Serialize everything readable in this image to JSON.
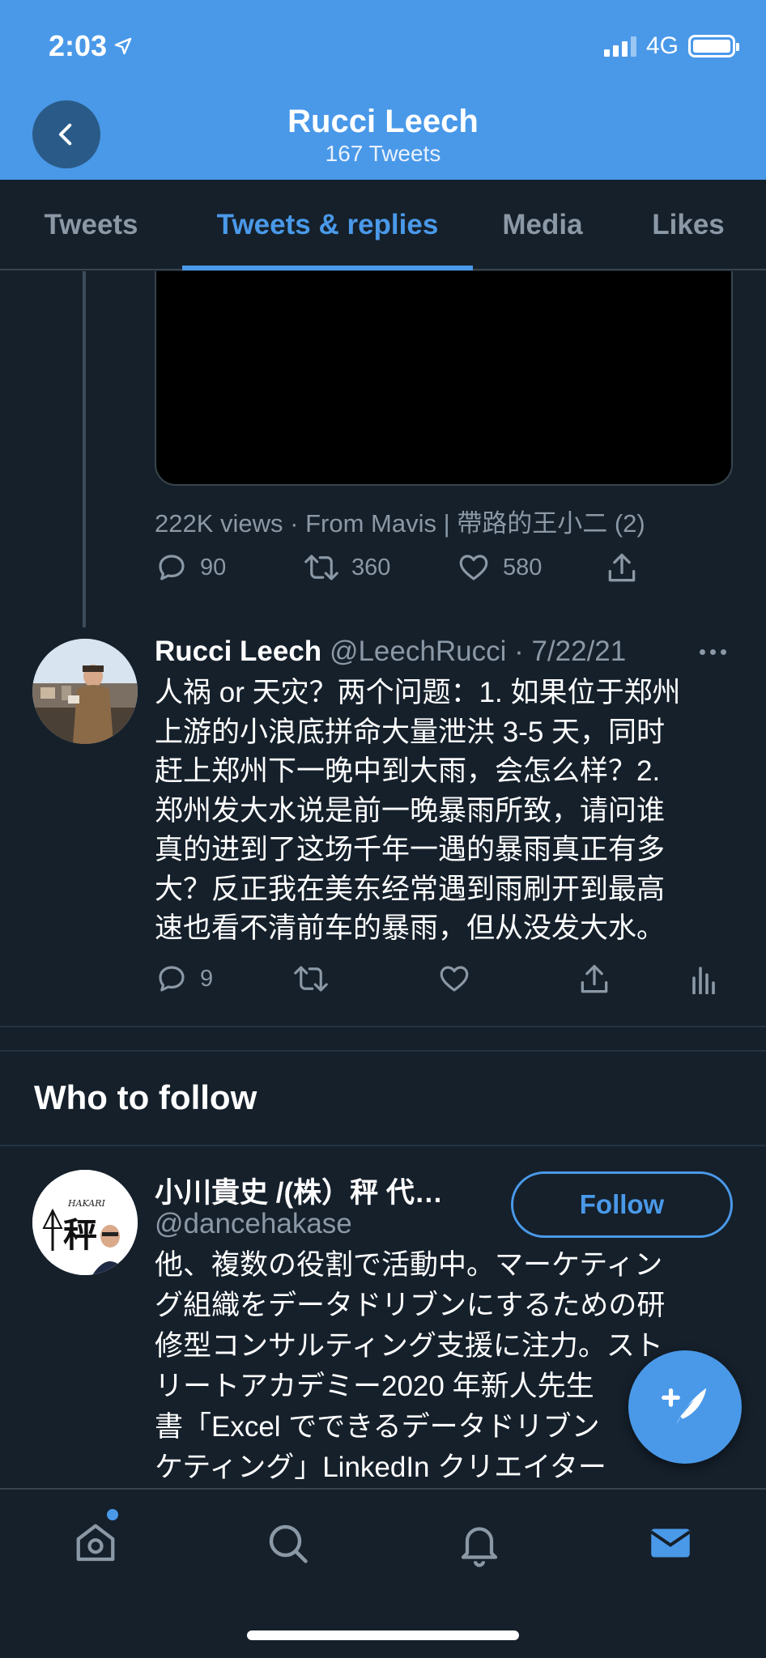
{
  "status_bar": {
    "time": "2:03",
    "network": "4G"
  },
  "header": {
    "name": "Rucci Leech",
    "tweet_count": "167 Tweets"
  },
  "tabs": [
    {
      "label": "Tweets"
    },
    {
      "label": "Tweets & replies",
      "active": true
    },
    {
      "label": "Media"
    },
    {
      "label": "Likes"
    }
  ],
  "tweet_prev": {
    "views": "222K views · From Mavis | 帶路的王小二 (2)",
    "reply_count": "90",
    "retweet_count": "360",
    "like_count": "580"
  },
  "tweet": {
    "name": "Rucci Leech",
    "meta": "@LeechRucci · 7/22/21",
    "text": "人祸 or 天灾？两个问题：1. 如果位于郑州\n上游的小浪底拼命大量泄洪 3-5 天，同时\n赶上郑州下一晚中到大雨，会怎么样？2.\n郑州发大水说是前一晚暴雨所致，请问谁\n真的进到了这场千年一遇的暴雨真正有多\n大？反正我在美东经常遇到雨刷开到最高\n速也看不清前车的暴雨，但从没发大水。",
    "reply_count": "9"
  },
  "who_to_follow": {
    "title": "Who to follow",
    "name": "小川貴史 /(株）秤 代…",
    "handle": "@dancehakase",
    "follow_label": "Follow",
    "bio": "他、複数の役割で活動中。マーケティン\nグ組織をデータドリブンにするための研\n修型コンサルティング支援に注力。スト\nリートアカデミー2020 年新人先生\n書「Excel でできるデータドリブン\nケティング」LinkedIn クリエイター",
    "avatar_text": "HAKARI",
    "avatar_kanji": "秤"
  },
  "colors": {
    "accent": "#4a99e9",
    "background": "#15202b",
    "muted": "#8b98a5"
  }
}
